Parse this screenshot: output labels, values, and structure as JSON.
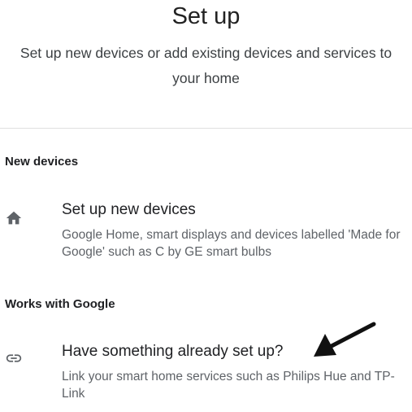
{
  "header": {
    "title": "Set up",
    "subtitle": "Set up new devices or add existing devices and services to your home"
  },
  "sections": [
    {
      "header": "New devices",
      "items": [
        {
          "icon": "home-icon",
          "title": "Set up new devices",
          "description": "Google Home, smart displays and devices labelled 'Made for Google' such as C by GE smart bulbs"
        }
      ]
    },
    {
      "header": "Works with Google",
      "items": [
        {
          "icon": "link-icon",
          "title": "Have something already set up?",
          "description": "Link your smart home services such as Philips Hue and TP-Link"
        }
      ]
    }
  ],
  "colors": {
    "icon": "#5f6368",
    "divider": "#e0e0e0",
    "annotation_arrow": "#111111"
  }
}
